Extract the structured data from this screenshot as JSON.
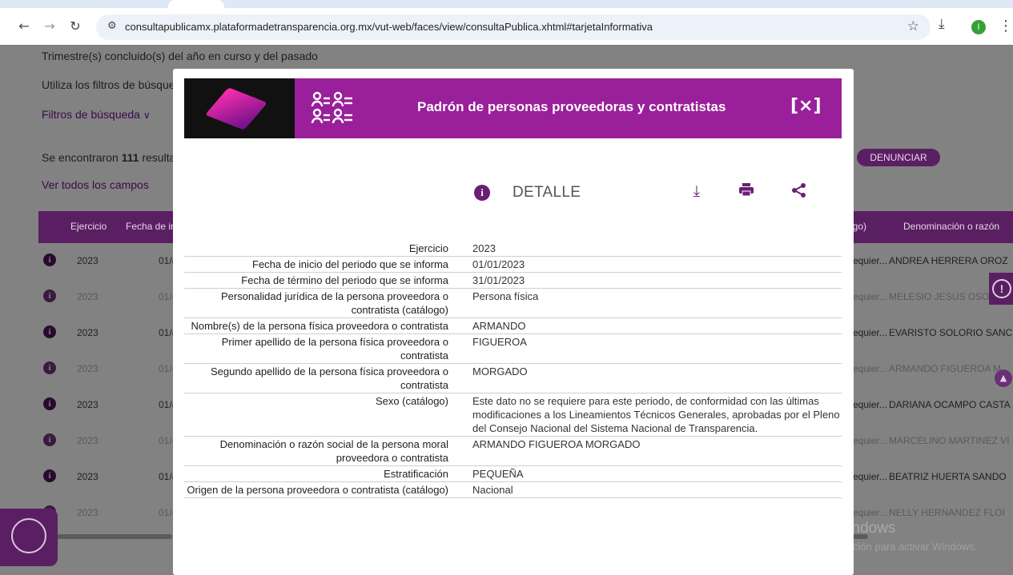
{
  "browser": {
    "url": "consultapublicamx.plataformadetransparencia.org.mx/vut-web/faces/view/consultaPublica.xhtml#tarjetaInformativa",
    "profile_initial": "I",
    "icons": [
      "back-arrow-icon",
      "forward-arrow-icon",
      "reload-icon",
      "site-settings-icon",
      "bookmark-star-icon",
      "download-icon",
      "menu-kebab-icon"
    ]
  },
  "background": {
    "line1": "Trimestre(s) concluido(s) del año en curso y del pasado",
    "line2": "Utiliza los filtros de búsque",
    "filters_label": "Filtros de búsqueda",
    "results_prefix": "Se encontraron ",
    "results_count": "111",
    "results_suffix": " resulta",
    "see_all": "Ver todos los campos",
    "denunciar": "DENUNCIAR",
    "headers": {
      "ejercicio": "Ejercicio",
      "fecha": "Fecha de in",
      "catalogo": "ogo)",
      "denominacion": "Denominación o razón"
    },
    "rows": [
      {
        "year": "2023",
        "date": "01/(",
        "req": "equier...",
        "name": "ANDREA HERRERA OROZ"
      },
      {
        "year": "2023",
        "date": "01/(",
        "req": "equier...",
        "name": "MELESIO JESÚS OSO"
      },
      {
        "year": "2023",
        "date": "01/(",
        "req": "equier...",
        "name": "EVARISTO SOLORIO SANC"
      },
      {
        "year": "2023",
        "date": "01/(",
        "req": "equier...",
        "name": "ARMANDO FIGUEROA M"
      },
      {
        "year": "2023",
        "date": "01/(",
        "req": "equier...",
        "name": "DARIANA OCAMPO CASTA"
      },
      {
        "year": "2023",
        "date": "01/(",
        "req": "equier...",
        "name": "MARCELINO MARTINEZ VI"
      },
      {
        "year": "2023",
        "date": "01/(",
        "req": "equier...",
        "name": "BEATRIZ HUERTA SANDO"
      },
      {
        "year": "2023",
        "date": "01/(",
        "req": "equier...",
        "name": "NELLY HERNANDEZ FLOI"
      }
    ],
    "watermark_title": "Activar Windows",
    "watermark_sub": "Ve a Configuración para activar Windows."
  },
  "modal": {
    "title": "Padrón de personas proveedoras y contratistas",
    "close_label": "[×]",
    "detail_label": "DETALLE",
    "fields": [
      {
        "k": "Ejercicio",
        "v": "2023"
      },
      {
        "k": "Fecha de inicio del periodo que se informa",
        "v": "01/01/2023"
      },
      {
        "k": "Fecha de término del periodo que se informa",
        "v": "31/01/2023"
      },
      {
        "k": "Personalidad jurídica de la persona proveedora o contratista (catálogo)",
        "v": "Persona física"
      },
      {
        "k": "Nombre(s) de la persona física proveedora o contratista",
        "v": "ARMANDO"
      },
      {
        "k": "Primer apellido de la persona física proveedora o contratista",
        "v": "FIGUEROA"
      },
      {
        "k": "Segundo apellido de la persona física proveedora o contratista",
        "v": "MORGADO"
      },
      {
        "k": "Sexo (catálogo)",
        "v": "Este dato no se requiere para este periodo, de conformidad con las últimas modificaciones a los Lineamientos Técnicos Generales, aprobadas por el Pleno del Consejo Nacional del Sistema Nacional de Transparencia."
      },
      {
        "k": "Denominación o razón social de la persona moral proveedora o contratista",
        "v": "ARMANDO FIGUEROA MORGADO"
      },
      {
        "k": "Estratificación",
        "v": "PEQUEÑA"
      },
      {
        "k": "Origen de la persona proveedora o contratista (catálogo)",
        "v": "Nacional"
      }
    ]
  },
  "colors": {
    "brand_purple": "#9a1f9a",
    "dark_purple": "#5a1f62",
    "icon_purple": "#6a1f74"
  }
}
